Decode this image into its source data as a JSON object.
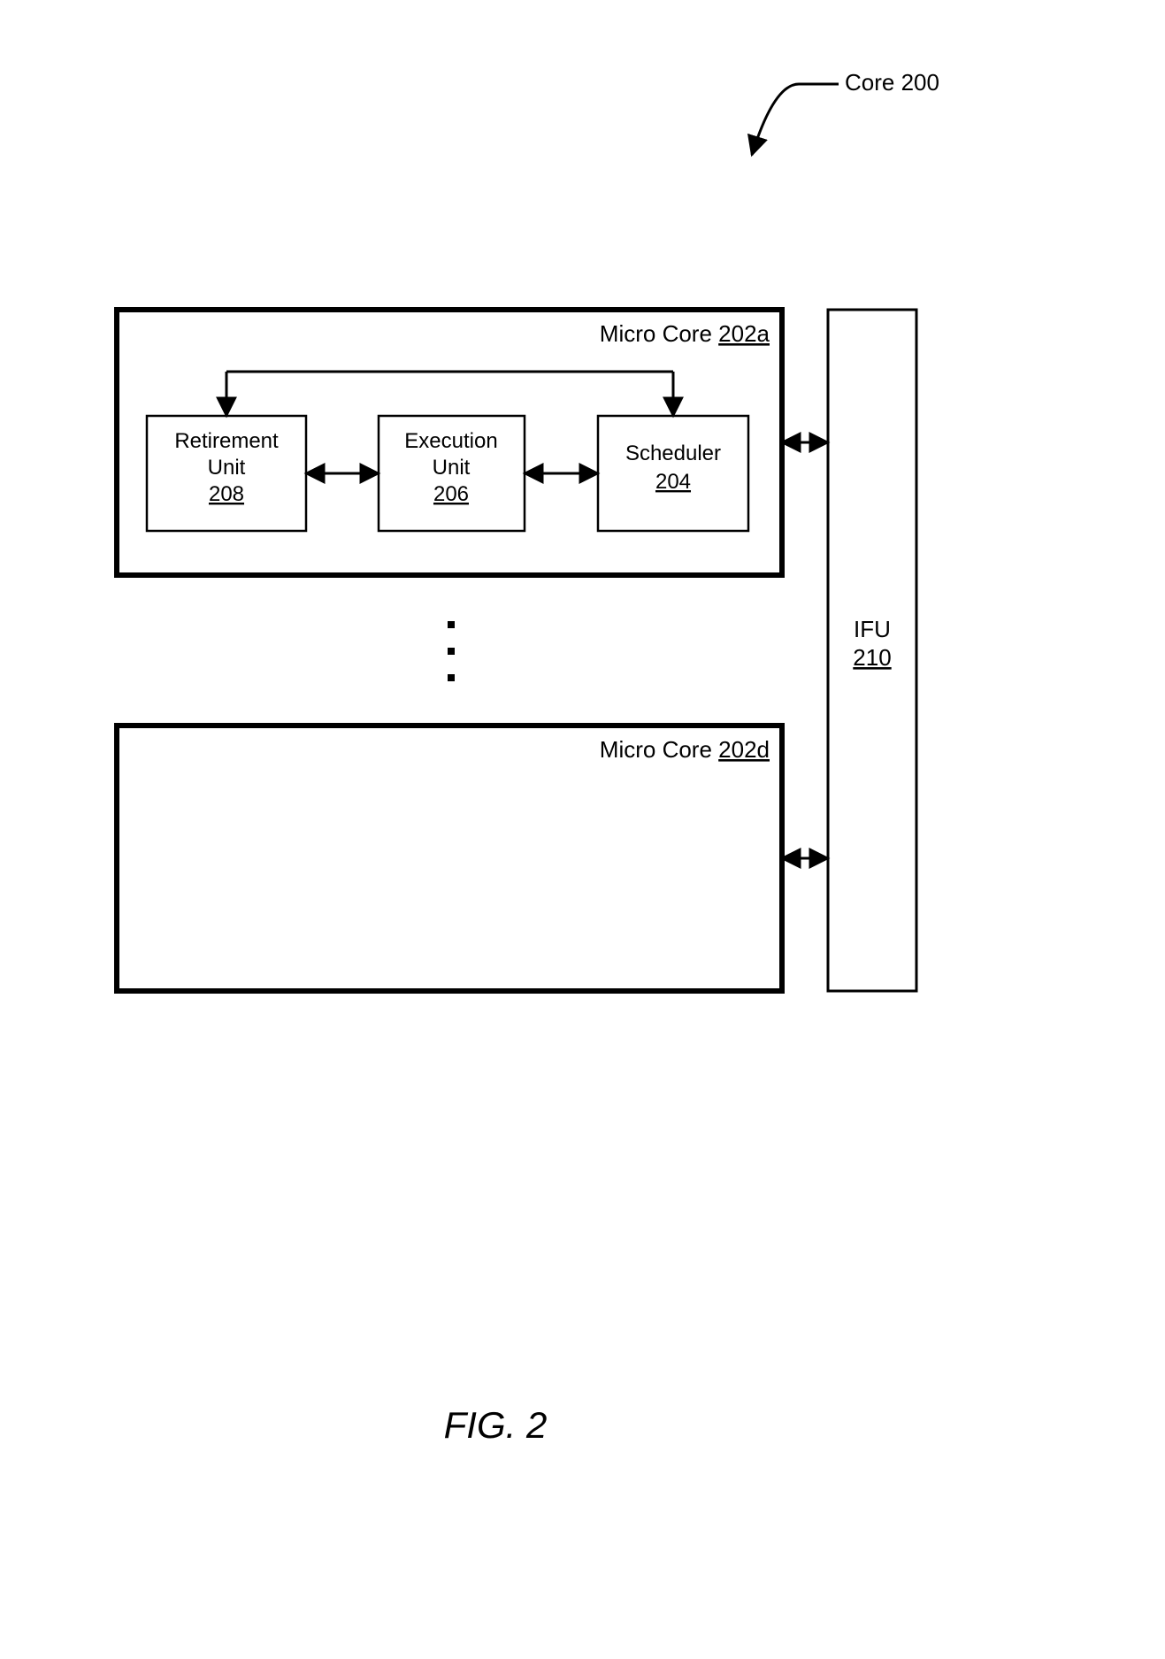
{
  "core_label_prefix": "Core ",
  "core_label_num": "200",
  "micro_core_a_prefix": "Micro Core ",
  "micro_core_a_num": "202a",
  "micro_core_d_prefix": "Micro Core ",
  "micro_core_d_num": "202d",
  "retirement_line1": "Retirement",
  "retirement_line2": "Unit",
  "retirement_num": "208",
  "execution_line1": "Execution",
  "execution_line2": "Unit",
  "execution_num": "206",
  "scheduler_label": "Scheduler",
  "scheduler_num": "204",
  "ifu_label": "IFU",
  "ifu_num": "210",
  "figure_caption": "FIG. 2"
}
